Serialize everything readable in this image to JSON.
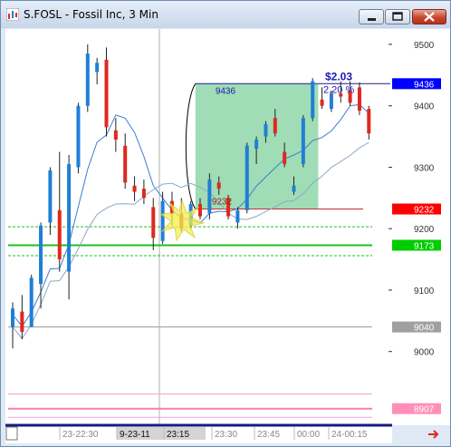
{
  "window": {
    "title": "S.FOSL - Fossil Inc, 3 Min"
  },
  "chart_data": {
    "type": "candlestick",
    "title": "S.FOSL - Fossil Inc, 3 Min",
    "y_ticks": [
      "9500",
      "9400",
      "9300",
      "9200",
      "9100",
      "9000"
    ],
    "y_tick_values": [
      9500,
      9400,
      9300,
      9200,
      9100,
      9000
    ],
    "ylim": [
      8880,
      9525
    ],
    "x_ticks": [
      "23-22:30",
      "9-23-11",
      "23:15",
      "23:30",
      "23:45",
      "00:00",
      "24-00:15"
    ],
    "price_tags": [
      {
        "label": "9436",
        "value": 9436,
        "color": "#0000ff"
      },
      {
        "label": "9232",
        "value": 9232,
        "color": "#ff0000"
      },
      {
        "label": "9173",
        "value": 9173,
        "color": "#00cc00"
      },
      {
        "label": "9040",
        "value": 9040,
        "color": "#a0a0a0"
      },
      {
        "label": "8907",
        "value": 8907,
        "color": "#ff8fb8"
      }
    ],
    "annotations": {
      "box_top_label": "9436",
      "box_bottom_label": "9232",
      "gain_dollar": "$2.03",
      "gain_percent": "2.20 %"
    },
    "colors": {
      "up": "#1e7fd6",
      "down": "#e0281e",
      "box_fill": "#8fd6a8",
      "box_border": "#1a1aa0"
    },
    "candles": [
      {
        "o": 9040,
        "h": 9080,
        "l": 9005,
        "c": 9070
      },
      {
        "o": 9065,
        "h": 9092,
        "l": 9020,
        "c": 9032
      },
      {
        "o": 9040,
        "h": 9125,
        "l": 9040,
        "c": 9120
      },
      {
        "o": 9110,
        "h": 9210,
        "l": 9070,
        "c": 9205
      },
      {
        "o": 9210,
        "h": 9300,
        "l": 9190,
        "c": 9295
      },
      {
        "o": 9230,
        "h": 9325,
        "l": 9130,
        "c": 9150
      },
      {
        "o": 9130,
        "h": 9320,
        "l": 9085,
        "c": 9305
      },
      {
        "o": 9300,
        "h": 9405,
        "l": 9290,
        "c": 9400
      },
      {
        "o": 9400,
        "h": 9500,
        "l": 9390,
        "c": 9485
      },
      {
        "o": 9455,
        "h": 9478,
        "l": 9435,
        "c": 9470
      },
      {
        "o": 9475,
        "h": 9495,
        "l": 9350,
        "c": 9365
      },
      {
        "o": 9360,
        "h": 9380,
        "l": 9325,
        "c": 9345
      },
      {
        "o": 9335,
        "h": 9355,
        "l": 9265,
        "c": 9275
      },
      {
        "o": 9270,
        "h": 9285,
        "l": 9245,
        "c": 9260
      },
      {
        "o": 9265,
        "h": 9280,
        "l": 9240,
        "c": 9250
      },
      {
        "o": 9235,
        "h": 9250,
        "l": 9165,
        "c": 9185
      },
      {
        "o": 9180,
        "h": 9260,
        "l": 9175,
        "c": 9245
      },
      {
        "o": 9245,
        "h": 9260,
        "l": 9205,
        "c": 9225
      },
      {
        "o": 9225,
        "h": 9250,
        "l": 9195,
        "c": 9200
      },
      {
        "o": 9205,
        "h": 9245,
        "l": 9200,
        "c": 9240
      },
      {
        "o": 9240,
        "h": 9250,
        "l": 9215,
        "c": 9220
      },
      {
        "o": 9225,
        "h": 9290,
        "l": 9215,
        "c": 9280
      },
      {
        "o": 9275,
        "h": 9285,
        "l": 9255,
        "c": 9265
      },
      {
        "o": 9250,
        "h": 9255,
        "l": 9215,
        "c": 9220
      },
      {
        "o": 9210,
        "h": 9235,
        "l": 9200,
        "c": 9230
      },
      {
        "o": 9230,
        "h": 9340,
        "l": 9225,
        "c": 9335
      },
      {
        "o": 9330,
        "h": 9350,
        "l": 9305,
        "c": 9345
      },
      {
        "o": 9350,
        "h": 9375,
        "l": 9340,
        "c": 9370
      },
      {
        "o": 9380,
        "h": 9395,
        "l": 9350,
        "c": 9355
      },
      {
        "o": 9325,
        "h": 9340,
        "l": 9300,
        "c": 9305
      },
      {
        "o": 9260,
        "h": 9285,
        "l": 9255,
        "c": 9270
      },
      {
        "o": 9305,
        "h": 9385,
        "l": 9300,
        "c": 9380
      },
      {
        "o": 9380,
        "h": 9445,
        "l": 9375,
        "c": 9440
      },
      {
        "o": 9410,
        "h": 9430,
        "l": 9395,
        "c": 9400
      },
      {
        "o": 9395,
        "h": 9425,
        "l": 9390,
        "c": 9420
      },
      {
        "o": 9420,
        "h": 9440,
        "l": 9405,
        "c": 9415
      },
      {
        "o": 9425,
        "h": 9440,
        "l": 9400,
        "c": 9405
      },
      {
        "o": 9430,
        "h": 9438,
        "l": 9385,
        "c": 9392
      },
      {
        "o": 9395,
        "h": 9400,
        "l": 9345,
        "c": 9355
      }
    ]
  }
}
